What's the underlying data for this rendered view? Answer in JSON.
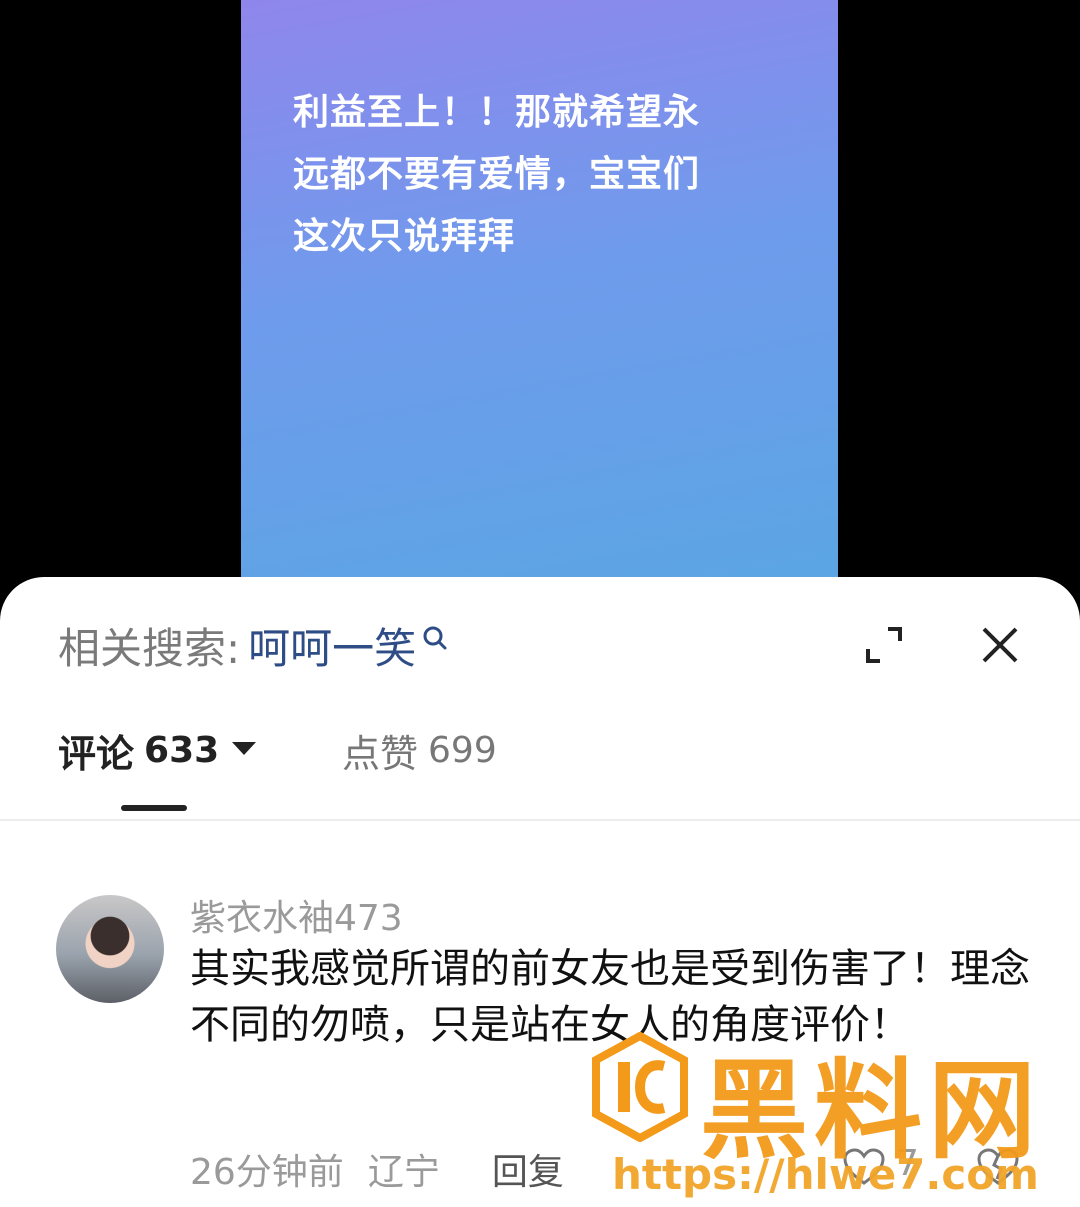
{
  "video": {
    "caption_line1": "利益至上！！那就希望永",
    "caption_line2": "远都不要有爱情，宝宝们",
    "caption_line3": "这次只说拜拜"
  },
  "search": {
    "prefix": "相关搜索:",
    "term": "呵呵一笑"
  },
  "tabs": {
    "comments_label": "评论",
    "comments_count": "633",
    "likes_label": "点赞",
    "likes_count": "699"
  },
  "comment": {
    "username": "紫衣水袖473",
    "text": "其实我感觉所谓的前女友也是受到伤害了！理念不同的勿喷，只是站在女人的角度评价！",
    "time": "26分钟前",
    "location": "辽宁",
    "reply_label": "回复",
    "like_count": "7"
  },
  "watermark": {
    "name": "黑料网",
    "url": "https://hlwe7.com"
  },
  "colors": {
    "link_blue": "#2e4d86",
    "watermark_orange": "#f39a1a"
  }
}
